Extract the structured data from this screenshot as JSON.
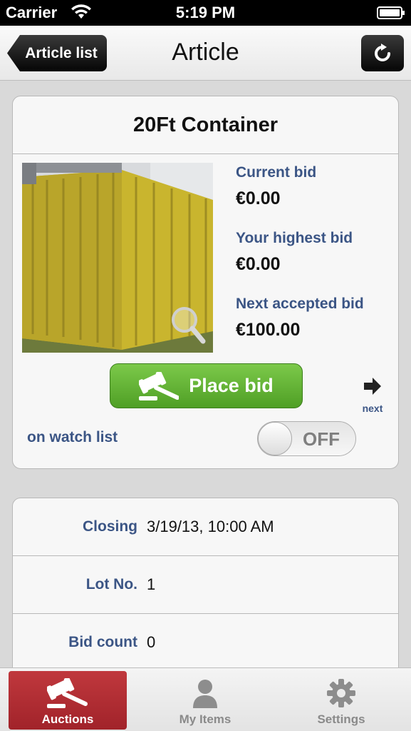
{
  "status_bar": {
    "carrier": "Carrier",
    "time": "5:19 PM"
  },
  "nav": {
    "back_label": "Article list",
    "title": "Article"
  },
  "article": {
    "title": "20Ft Container",
    "current_bid_label": "Current bid",
    "current_bid_value": "€0.00",
    "your_highest_bid_label": "Your highest bid",
    "your_highest_bid_value": "€0.00",
    "next_accepted_bid_label": "Next accepted bid",
    "next_accepted_bid_value": "€100.00",
    "place_bid_label": "Place bid",
    "next_label": "next",
    "watch_list_label": "on watch list",
    "watch_toggle_state": "OFF"
  },
  "details": {
    "rows": [
      {
        "label": "Closing",
        "value": "3/19/13, 10:00 AM"
      },
      {
        "label": "Lot No.",
        "value": "1"
      },
      {
        "label": "Bid count",
        "value": "0"
      }
    ]
  },
  "tabs": {
    "auctions": "Auctions",
    "my_items": "My Items",
    "settings": "Settings"
  },
  "colors": {
    "accent_blue": "#3b5585",
    "bid_green": "#5aaf2e",
    "tab_active_red": "#b52d33"
  }
}
